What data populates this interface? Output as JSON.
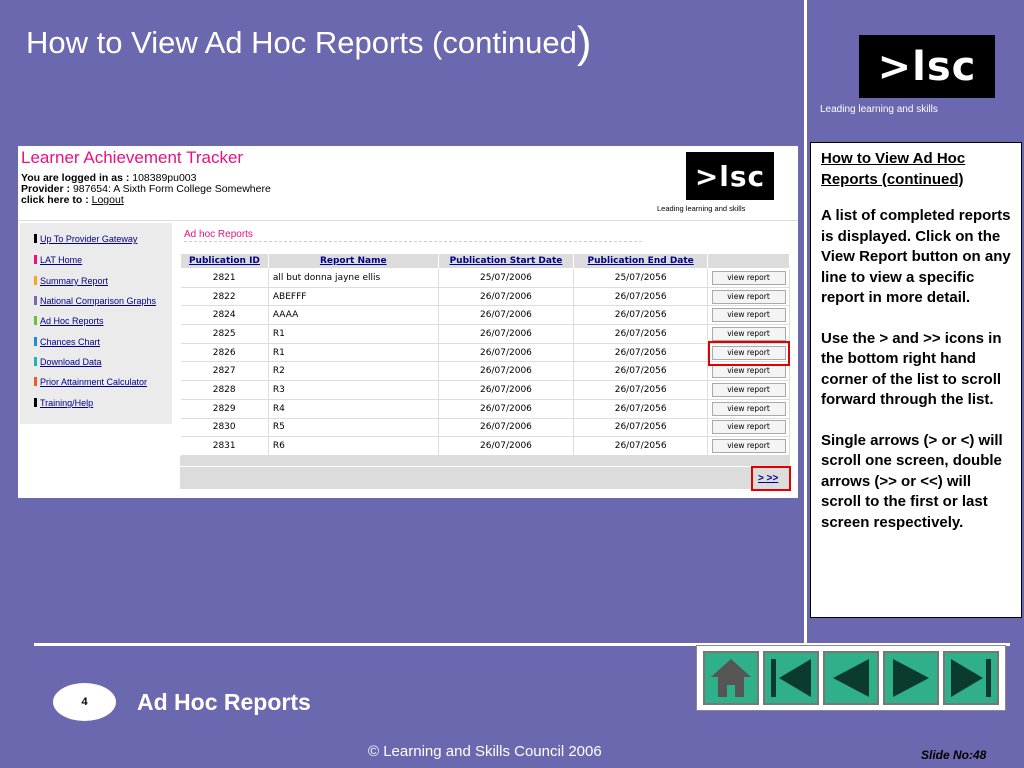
{
  "slide": {
    "title": "How to View Ad Hoc Reports (continued",
    "title_paren": ")",
    "logo_text": ">lsc",
    "logo_tagline": "Leading learning and skills"
  },
  "explanation": {
    "heading": "How to View Ad Hoc Reports (continued)",
    "paragraphs": [
      "A list of completed reports is displayed. Click on the View Report button on any line to view a specific report in more detail.",
      "Use the > and >> icons in the bottom right hand corner of the list to scroll forward through the list.",
      "Single arrows (> or <) will scroll one screen, double arrows (>> or <<) will scroll to the first or last screen respectively."
    ]
  },
  "app": {
    "title": "Learner Achievement Tracker",
    "logged_in_label": "You are logged in as :",
    "logged_in_value": "108389pu003",
    "provider_label": "Provider :",
    "provider_value": "987654: A Sixth Form College Somewhere",
    "click_label": "click here to :",
    "logout_link": "Logout",
    "logo_text": ">lsc",
    "logo_tagline": "Leading learning and skills",
    "section_title": "Ad hoc Reports",
    "nav": [
      {
        "label": "Up To Provider Gateway",
        "color": "#000000"
      },
      {
        "label": "LAT Home",
        "color": "#e8117f"
      },
      {
        "label": "Summary Report",
        "color": "#f5a623"
      },
      {
        "label": "National Comparison Graphs",
        "color": "#7b68ae"
      },
      {
        "label": "Ad Hoc Reports",
        "color": "#6dbf3b"
      },
      {
        "label": "Chances Chart",
        "color": "#1e90c8"
      },
      {
        "label": "Download Data",
        "color": "#1eb4b4"
      },
      {
        "label": "Prior Attainment Calculator",
        "color": "#f05a28"
      },
      {
        "label": "Training/Help",
        "color": "#000000"
      }
    ],
    "table": {
      "headers": [
        "Publication ID",
        "Report Name",
        "Publication Start Date",
        "Publication End Date",
        ""
      ],
      "view_label": "view report",
      "rows": [
        [
          "2821",
          "all but donna jayne ellis",
          "25/07/2006",
          "25/07/2056"
        ],
        [
          "2822",
          "ABEFFF",
          "26/07/2006",
          "26/07/2056"
        ],
        [
          "2824",
          "AAAA",
          "26/07/2006",
          "26/07/2056"
        ],
        [
          "2825",
          "R1",
          "26/07/2006",
          "26/07/2056"
        ],
        [
          "2826",
          "R1",
          "26/07/2006",
          "26/07/2056"
        ],
        [
          "2827",
          "R2",
          "26/07/2006",
          "26/07/2056"
        ],
        [
          "2828",
          "R3",
          "26/07/2006",
          "26/07/2056"
        ],
        [
          "2829",
          "R4",
          "26/07/2006",
          "26/07/2056"
        ],
        [
          "2830",
          "R5",
          "26/07/2006",
          "26/07/2056"
        ],
        [
          "2831",
          "R6",
          "26/07/2006",
          "26/07/2056"
        ]
      ]
    },
    "pager_next": ">",
    "pager_last": ">>"
  },
  "footer": {
    "slide_number": "4",
    "section": "Ad Hoc Reports",
    "copyright": "© Learning and Skills Council 2006",
    "slide_no": "Slide No:48",
    "nav_buttons": [
      "home-icon",
      "first-icon",
      "previous-icon",
      "next-icon",
      "last-icon"
    ],
    "nav_color": "#2fb08a"
  }
}
